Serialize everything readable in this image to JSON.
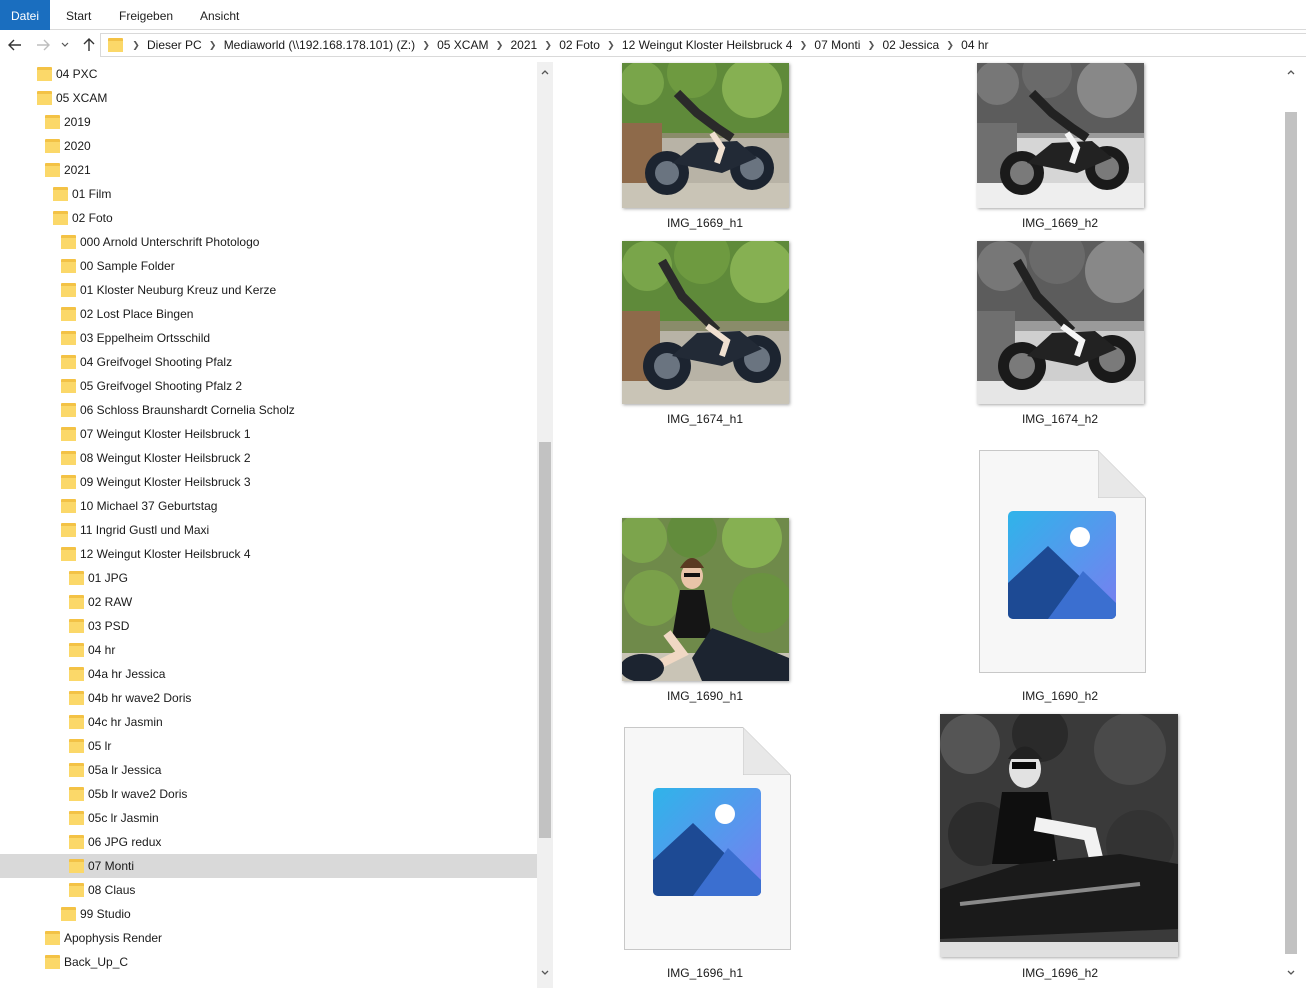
{
  "ribbon": {
    "tabs": [
      {
        "label": "Datei",
        "active": true
      },
      {
        "label": "Start",
        "active": false
      },
      {
        "label": "Freigeben",
        "active": false
      },
      {
        "label": "Ansicht",
        "active": false
      }
    ]
  },
  "address": {
    "crumbs": [
      "Dieser PC",
      "Mediaworld (\\\\192.168.178.101) (Z:)",
      "05 XCAM",
      "2021",
      "02 Foto",
      "12 Weingut Kloster Heilsbruck 4",
      "07 Monti",
      "02 Jessica",
      "04 hr"
    ]
  },
  "tree": {
    "items": [
      {
        "label": "04 PXC",
        "selected": false
      },
      {
        "label": "05 XCAM",
        "selected": false
      },
      {
        "label": "2019",
        "selected": false
      },
      {
        "label": "2020",
        "selected": false
      },
      {
        "label": "2021",
        "selected": false
      },
      {
        "label": "01 Film",
        "selected": false
      },
      {
        "label": "02 Foto",
        "selected": false
      },
      {
        "label": "000 Arnold Unterschrift Photologo",
        "selected": false
      },
      {
        "label": "00 Sample Folder",
        "selected": false
      },
      {
        "label": "01 Kloster Neuburg Kreuz und Kerze",
        "selected": false
      },
      {
        "label": "02 Lost Place Bingen",
        "selected": false
      },
      {
        "label": "03 Eppelheim Ortsschild",
        "selected": false
      },
      {
        "label": "04 Greifvogel Shooting Pfalz",
        "selected": false
      },
      {
        "label": "05 Greifvogel Shooting Pfalz 2",
        "selected": false
      },
      {
        "label": "06 Schloss Braunshardt Cornelia Scholz",
        "selected": false
      },
      {
        "label": "07 Weingut Kloster Heilsbruck 1",
        "selected": false
      },
      {
        "label": "08 Weingut Kloster Heilsbruck 2",
        "selected": false
      },
      {
        "label": "09 Weingut Kloster Heilsbruck 3",
        "selected": false
      },
      {
        "label": "10 Michael 37 Geburtstag",
        "selected": false
      },
      {
        "label": "11 Ingrid Gustl und Maxi",
        "selected": false
      },
      {
        "label": "12 Weingut Kloster Heilsbruck 4",
        "selected": false
      },
      {
        "label": "01 JPG",
        "selected": false
      },
      {
        "label": "02 RAW",
        "selected": false
      },
      {
        "label": "03 PSD",
        "selected": false
      },
      {
        "label": "04 hr",
        "selected": false
      },
      {
        "label": "04a hr Jessica",
        "selected": false
      },
      {
        "label": "04b hr wave2 Doris",
        "selected": false
      },
      {
        "label": "04c hr Jasmin",
        "selected": false
      },
      {
        "label": "05 lr",
        "selected": false
      },
      {
        "label": "05a lr Jessica",
        "selected": false
      },
      {
        "label": "05b lr wave2 Doris",
        "selected": false
      },
      {
        "label": "05c lr Jasmin",
        "selected": false
      },
      {
        "label": "06 JPG redux",
        "selected": false
      },
      {
        "label": "07 Monti",
        "selected": true
      },
      {
        "label": "08 Claus",
        "selected": false
      },
      {
        "label": "99 Studio",
        "selected": false
      },
      {
        "label": "Apophysis Render",
        "selected": false
      },
      {
        "label": "Back_Up_C",
        "selected": false
      }
    ]
  },
  "files": [
    {
      "name": "IMG_1669_h1",
      "kind": "photo-color"
    },
    {
      "name": "IMG_1669_h2",
      "kind": "photo-bw"
    },
    {
      "name": "IMG_1674_h1",
      "kind": "photo-color"
    },
    {
      "name": "IMG_1674_h2",
      "kind": "photo-bw"
    },
    {
      "name": "IMG_1690_h1",
      "kind": "photo-color"
    },
    {
      "name": "IMG_1690_h2",
      "kind": "generic-image-file"
    },
    {
      "name": "IMG_1696_h1",
      "kind": "generic-image-file"
    },
    {
      "name": "IMG_1696_h2",
      "kind": "photo-bw"
    }
  ],
  "icons": {
    "back": "arrow-left-icon",
    "forward": "arrow-right-icon",
    "recent": "chevron-down-icon",
    "up": "arrow-up-icon",
    "folder": "folder-icon",
    "image_file": "image-file-icon"
  },
  "colors": {
    "accent": "#1a6ebf",
    "selection": "#d9d9d9",
    "folder": "#fbd869"
  }
}
